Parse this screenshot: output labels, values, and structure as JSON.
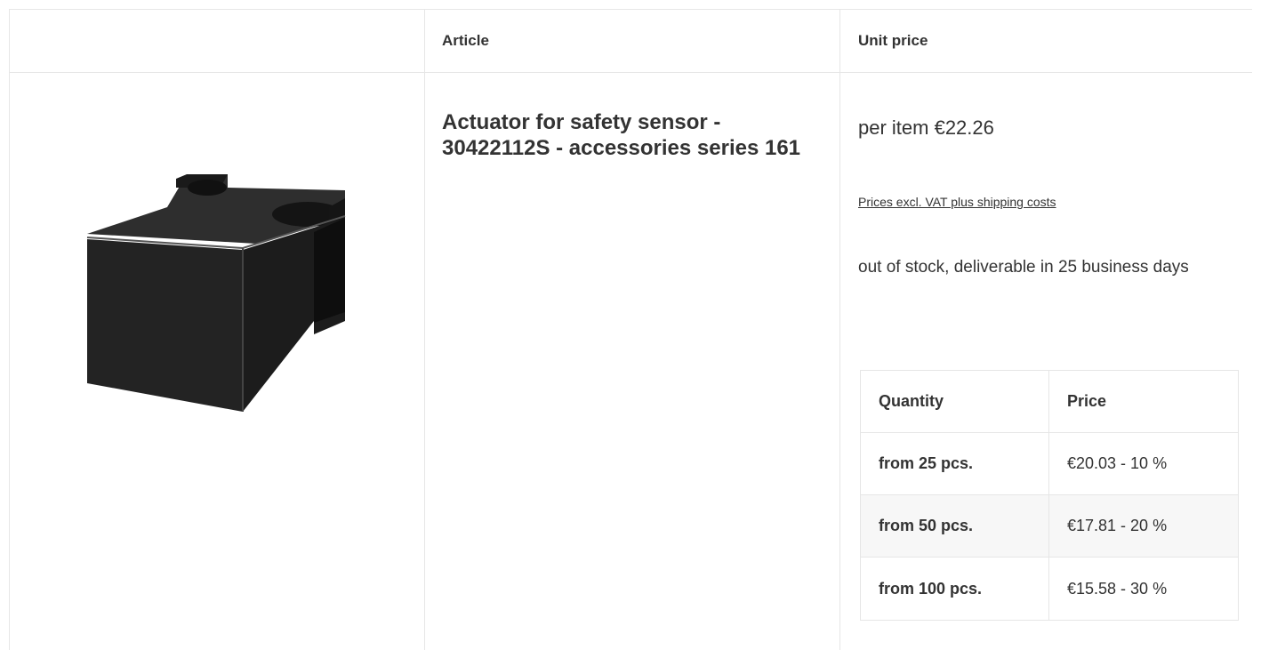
{
  "table": {
    "col_article": "Article",
    "col_unit_price": "Unit price"
  },
  "product": {
    "image_icon": "product-photo-black-actuator-block",
    "title": "Actuator for safety sensor - 30422112S - accessories series 161",
    "price_line": "per item €22.26",
    "vat_link": "Prices excl. VAT plus shipping costs",
    "stock": "out of stock, deliverable in 25 business days"
  },
  "tiers": {
    "header_quantity": "Quantity",
    "header_price": "Price",
    "rows": [
      {
        "quantity": "from 25 pcs.",
        "price": "€20.03 - 10 %"
      },
      {
        "quantity": "from 50 pcs.",
        "price": "€17.81 - 20 %"
      },
      {
        "quantity": "from 100 pcs.",
        "price": "€15.58 - 30 %"
      }
    ]
  }
}
